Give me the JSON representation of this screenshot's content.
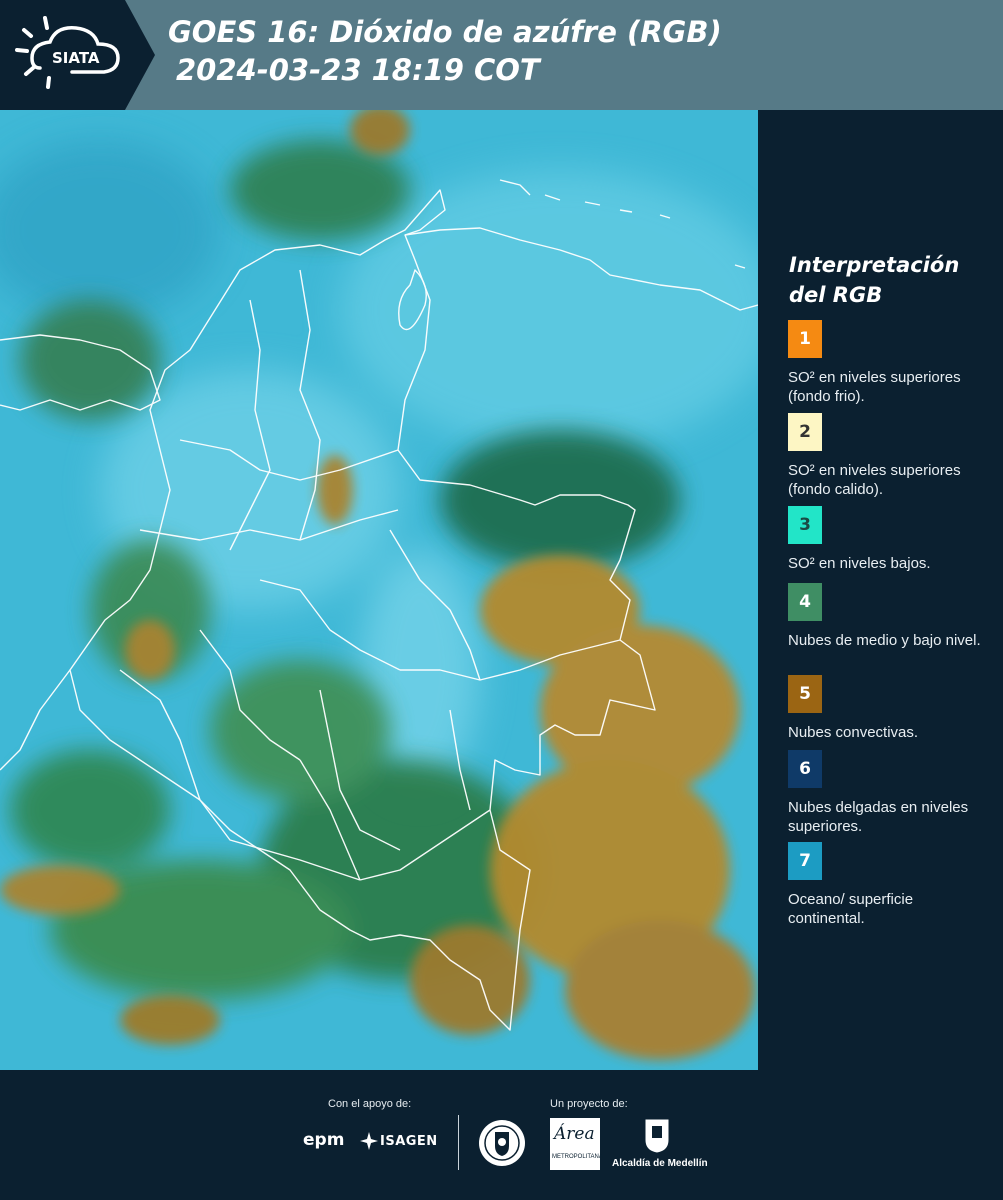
{
  "header": {
    "logo_text": "SIATA",
    "title_line1": "GOES 16: Dióxido de azúfre (RGB)",
    "title_line2": "2024-03-23 18:19 COT"
  },
  "legend": {
    "title": "Interpretación del RGB",
    "items": [
      {
        "number": "1",
        "color": "#f58a12",
        "text": "SO² en niveles superiores (fondo frio)."
      },
      {
        "number": "2",
        "color": "#fdf6c4",
        "text": "SO² en niveles superiores (fondo calido)."
      },
      {
        "number": "3",
        "color": "#22e5c8",
        "text": "SO² en niveles bajos."
      },
      {
        "number": "4",
        "color": "#3f8e64",
        "text": "Nubes de medio y bajo nivel."
      },
      {
        "number": "5",
        "color": "#9b6513",
        "text": "Nubes convectivas."
      },
      {
        "number": "6",
        "color": "#0f3a68",
        "text": "Nubes delgadas en niveles superiores."
      },
      {
        "number": "7",
        "color": "#1c9cc3",
        "text": "Oceano/ superficie continental."
      }
    ]
  },
  "footer": {
    "support_label": "Con el apoyo de:",
    "project_label": "Un proyecto de:",
    "epm": "epm",
    "isagen": "ISAGEN",
    "area_logo_text": "Área",
    "area_subtext": "METROPOLITANA",
    "alcaldia": "Alcaldía de Medellín"
  },
  "colors": {
    "header_bg": "#567a87",
    "panel_bg": "#0b2030",
    "ocean_cyan": "#3fb8d6",
    "cloud_green": "#2f8a55",
    "cloud_brown": "#b38a2e"
  }
}
